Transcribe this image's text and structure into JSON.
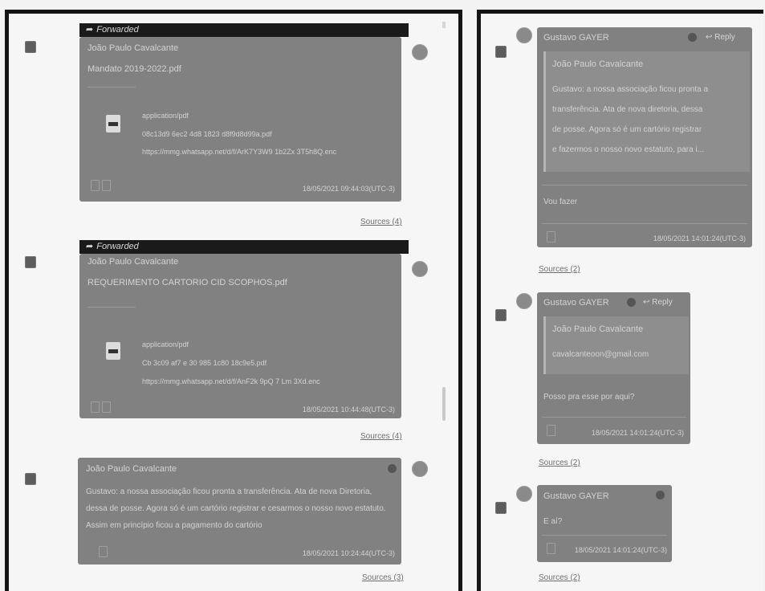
{
  "left": {
    "messages": [
      {
        "forwarded_label": "Forwarded",
        "sender": "João Paulo Cavalcante",
        "filename": "Mandato 2019-2022.pdf",
        "file_meta_1": "application/pdf",
        "file_meta_2": "08c13d9 6ec2 4d8 1823 d8f9d8d99a.pdf",
        "file_meta_3": "https://mmg.whatsapp.net/d/f/ArK7Y3W9 1b2Zx 3T5h8Q.enc",
        "timestamp": "18/05/2021 09:44:03(UTC-3)",
        "sources": "Sources (4)"
      },
      {
        "forwarded_label": "Forwarded",
        "sender": "João Paulo Cavalcante",
        "filename": "REQUERIMENTO CARTORIO CID SCOPHOS.pdf",
        "file_meta_1": "application/pdf",
        "file_meta_2": "Cb 3c09 af7 e 30 985 1c80 18c9e5.pdf",
        "file_meta_3": "https://mmg.whatsapp.net/d/f/AnF2k 9pQ 7 Lm 3Xd.enc",
        "timestamp": "18/05/2021 10:44:48(UTC-3)",
        "sources": "Sources (4)"
      },
      {
        "sender": "João Paulo Cavalcante",
        "text": "Gustavo: a nossa associação ficou pronta a transferência. Ata de nova Diretoria, dessa de posse. Agora só é um cartório registrar e cesarmos o nosso novo estatuto. Assim em princípio ficou a pagamento do cartório",
        "timestamp": "18/05/2021 10:24:44(UTC-3)",
        "sources": "Sources (3)"
      }
    ]
  },
  "right": {
    "messages": [
      {
        "sender": "Gustavo GAYER",
        "reply_label": "Reply",
        "quote_sender": "João Paulo Cavalcante",
        "quote_text_lines": [
          "Gustavo: a nossa associação ficou pronta a",
          "transferência. Ata de nova diretoria, dessa",
          "de posse. Agora só é um cartório registrar",
          "e fazermos o nosso novo estatuto, para i..."
        ],
        "text": "Vou fazer",
        "timestamp": "18/05/2021 14:01:24(UTC-3)",
        "sources": "Sources (2)"
      },
      {
        "sender": "Gustavo GAYER",
        "reply_label": "Reply",
        "quote_sender": "João Paulo Cavalcante",
        "quote_text": "cavalcanteoon@gmail.com",
        "text": "Posso pra esse por aqui?",
        "timestamp": "18/05/2021 14:01:24(UTC-3)",
        "sources": "Sources (2)"
      },
      {
        "sender": "Gustavo GAYER",
        "text": "E aí?",
        "timestamp": "18/05/2021 14:01:24(UTC-3)",
        "sources": "Sources (2)"
      }
    ]
  },
  "colors": {
    "bubble": "#818181",
    "forward_bar": "#1a1a1a",
    "frame": "#141414"
  },
  "icons": [
    "forward-arrow-icon",
    "pdf-file-icon",
    "select-checkbox-icon",
    "avatar",
    "reply-arrow-icon",
    "info-icon",
    "media-icon"
  ]
}
